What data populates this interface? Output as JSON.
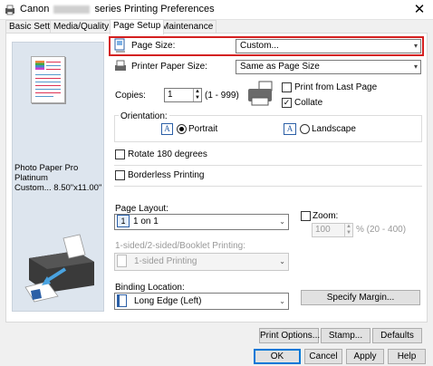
{
  "window": {
    "title_prefix": "Canon",
    "title_suffix": "series Printing Preferences",
    "close_glyph": "✕"
  },
  "tabs": [
    {
      "label": "Basic Settings"
    },
    {
      "label": "Media/Quality"
    },
    {
      "label": "Page Setup"
    },
    {
      "label": "Maintenance"
    }
  ],
  "preview": {
    "media_line1": "Photo Paper Pro Platinum",
    "media_line2": "Custom... 8.50\"x11.00\""
  },
  "page_size": {
    "label": "Page Size:",
    "value": "Custom..."
  },
  "printer_paper_size": {
    "label": "Printer Paper Size:",
    "value": "Same as Page Size"
  },
  "copies": {
    "label": "Copies:",
    "value": "1",
    "range": "(1 - 999)"
  },
  "print_from_last_page": {
    "label": "Print from Last Page",
    "checked": false
  },
  "collate": {
    "label": "Collate",
    "checked": true,
    "check_glyph": "✓"
  },
  "orientation": {
    "label": "Orientation:",
    "portrait": "Portrait",
    "landscape": "Landscape",
    "selected": "Portrait",
    "icon_letter": "A"
  },
  "rotate_180": {
    "label": "Rotate 180 degrees",
    "checked": false
  },
  "borderless": {
    "label": "Borderless Printing",
    "checked": false
  },
  "page_layout": {
    "label": "Page Layout:",
    "value": "1 on 1",
    "icon_number": "1"
  },
  "zoom": {
    "label": "Zoom:",
    "value": "100",
    "range": "% (20 - 400)",
    "checked": false
  },
  "sided": {
    "label": "1-sided/2-sided/Booklet Printing:",
    "value": "1-sided Printing"
  },
  "binding": {
    "label": "Binding Location:",
    "value": "Long Edge (Left)"
  },
  "buttons": {
    "specify_margin": "Specify Margin...",
    "print_options": "Print Options...",
    "stamp": "Stamp...",
    "defaults": "Defaults",
    "ok": "OK",
    "cancel": "Cancel",
    "apply": "Apply",
    "help": "Help"
  },
  "colors": {
    "highlight_border": "#d42020",
    "panel_bg": "#ffffff",
    "preview_bg": "#dde5ee"
  }
}
